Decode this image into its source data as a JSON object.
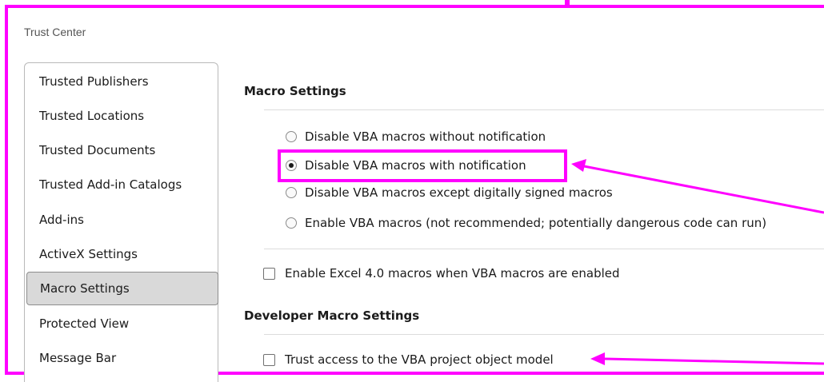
{
  "window": {
    "title": "Trust Center"
  },
  "sidebar": {
    "items": [
      {
        "label": "Trusted Publishers",
        "selected": false
      },
      {
        "label": "Trusted Locations",
        "selected": false
      },
      {
        "label": "Trusted Documents",
        "selected": false
      },
      {
        "label": "Trusted Add-in Catalogs",
        "selected": false
      },
      {
        "label": "Add-ins",
        "selected": false
      },
      {
        "label": "ActiveX Settings",
        "selected": false
      },
      {
        "label": "Macro Settings",
        "selected": true
      },
      {
        "label": "Protected View",
        "selected": false
      },
      {
        "label": "Message Bar",
        "selected": false
      }
    ]
  },
  "macro_settings": {
    "heading": "Macro Settings",
    "options": [
      {
        "label": "Disable VBA macros without notification",
        "checked": false
      },
      {
        "label": "Disable VBA macros with notification",
        "checked": true
      },
      {
        "label": "Disable VBA macros except digitally signed macros",
        "checked": false
      },
      {
        "label": "Enable VBA macros (not recommended; potentially dangerous code can run)",
        "checked": false
      }
    ],
    "excel4_checkbox": {
      "label": "Enable Excel 4.0 macros when VBA macros are enabled",
      "checked": false
    }
  },
  "developer_macro_settings": {
    "heading": "Developer Macro Settings",
    "trust_vba_checkbox": {
      "label": "Trust access to the VBA project object model",
      "checked": false
    }
  },
  "annotation": {
    "color": "#ff00ff"
  }
}
